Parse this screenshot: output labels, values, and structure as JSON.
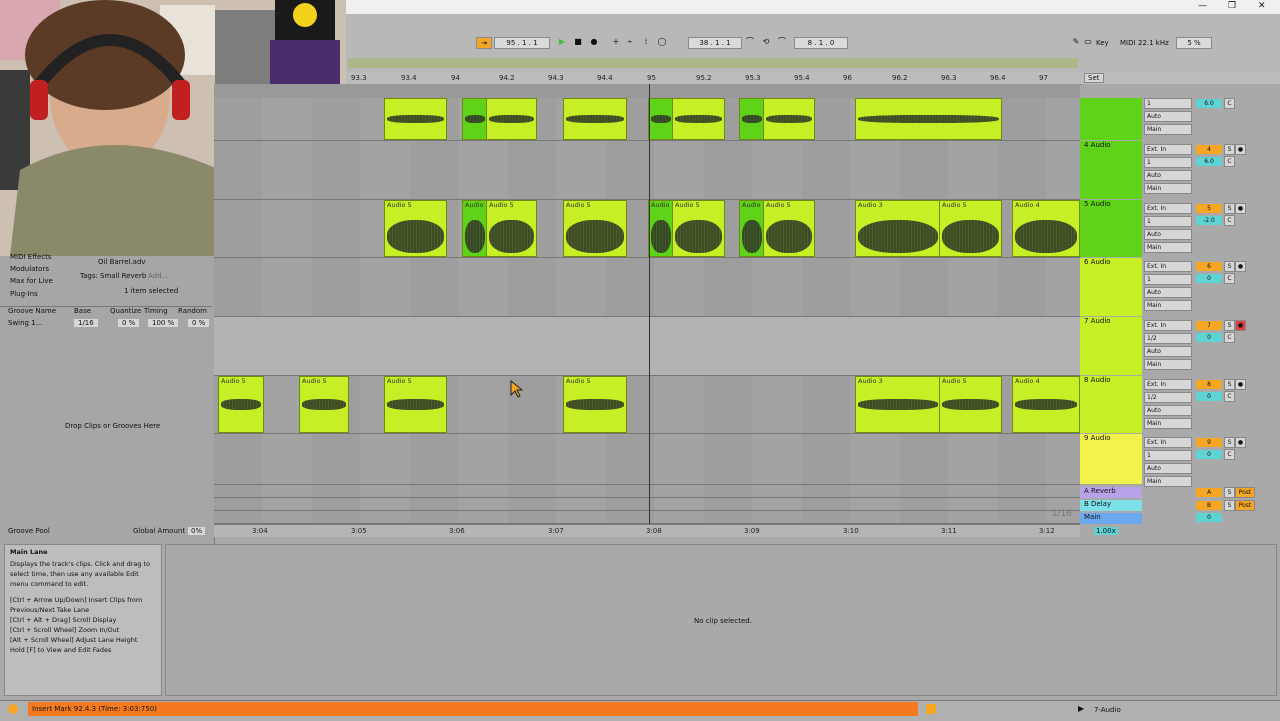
{
  "window": {
    "minimize": "—",
    "restore": "❐",
    "close": "✕"
  },
  "transport": {
    "follow_label": "⇥",
    "tempo_position": "95 . 1 . 1",
    "arrangement_position": "38 . 1 . 1",
    "loop_length": "8 . 1 . 0",
    "key_label": "Key",
    "midi_label": "MIDI",
    "sample_rate": "22.1 kHz",
    "cpu": "5 %"
  },
  "browser": {
    "categories": [
      "MIDI Effects",
      "Modulators",
      "Max for Live",
      "Plug-Ins"
    ],
    "selected_file": "Oil Barrel.adv",
    "tags_label": "Tags:",
    "tag": "Small Reverb",
    "tag_add": "Add...",
    "selection_text": "1 item selected",
    "groove_headers": [
      "Groove Name",
      "Base",
      "Quantize",
      "Timing",
      "Random"
    ],
    "groove_row": {
      "name": "Swing 1...",
      "base": "1/16",
      "quantize": "0 %",
      "timing": "100 %",
      "random": "0 %"
    },
    "drop_text": "Drop Clips or Grooves Here",
    "groove_pool": "Groove Pool",
    "global_amount_label": "Global Amount",
    "global_amount": "0%"
  },
  "ruler": {
    "marks": [
      "93.3",
      "93.4",
      "94",
      "94.2",
      "94.3",
      "94.4",
      "95",
      "95.2",
      "95.3",
      "95.4",
      "96",
      "96.2",
      "96.3",
      "96.4",
      "97"
    ]
  },
  "timeruler": {
    "marks": [
      "3:04",
      "3:05",
      "3:06",
      "3:07",
      "3:08",
      "3:09",
      "3:10",
      "3:11",
      "3:12"
    ],
    "grid": "1/16"
  },
  "clips": {
    "audio5": "Audio 5",
    "audio3": "Audio 3",
    "audio4": "Audio 4",
    "audio_short": "Audio"
  },
  "tracks": [
    {
      "name": "",
      "num": "3",
      "color": "#5fd317"
    },
    {
      "name": "4 Audio",
      "num": "4",
      "color": "#5fd317"
    },
    {
      "name": "5 Audio",
      "num": "5",
      "color": "#5fd317"
    },
    {
      "name": "6 Audio",
      "num": "6",
      "color": "#c6ef25"
    },
    {
      "name": "7 Audio",
      "num": "7",
      "color": "#c6ef25"
    },
    {
      "name": "8 Audio",
      "num": "8",
      "color": "#c6ef25"
    },
    {
      "name": "9 Audio",
      "num": "9",
      "color": "#f2f24a"
    }
  ],
  "io": {
    "input": "Ext. In",
    "channel": "1",
    "channel_half": "1/2",
    "in": "In",
    "auto": "Auto",
    "off": "Off",
    "main": "Main",
    "vol": "-∞",
    "pan": "C",
    "vol_value_4": "6.0",
    "vol_value_5": "-2.0",
    "vol_zero": "0"
  },
  "returns": [
    {
      "name": "A Reverb",
      "letter": "A",
      "post": "Post"
    },
    {
      "name": "B Delay",
      "letter": "B",
      "post": "Post"
    },
    {
      "name": "Main",
      "letter": "0",
      "post": "1/2"
    }
  ],
  "set_label": "Set",
  "zoom": "1.00x",
  "info": {
    "title": "Main Lane",
    "body": "Displays the track's clips. Click and drag to select time, then use any available Edit menu command to edit.",
    "lines": [
      "[Ctrl + Arrow Up/Down] Insert Clips from Previous/Next Take Lane",
      "[Ctrl + Alt + Drag] Scroll Display",
      "[Ctrl + Scroll Wheel] Zoom In/Out",
      "[Alt + Scroll Wheel] Adjust Lane Height",
      "Hold [F] to View and Edit Fades"
    ]
  },
  "clipview_text": "No clip selected.",
  "status": {
    "message": "Insert Mark 92.4.3 (Time: 3:03:750)",
    "track": "7-Audio"
  }
}
